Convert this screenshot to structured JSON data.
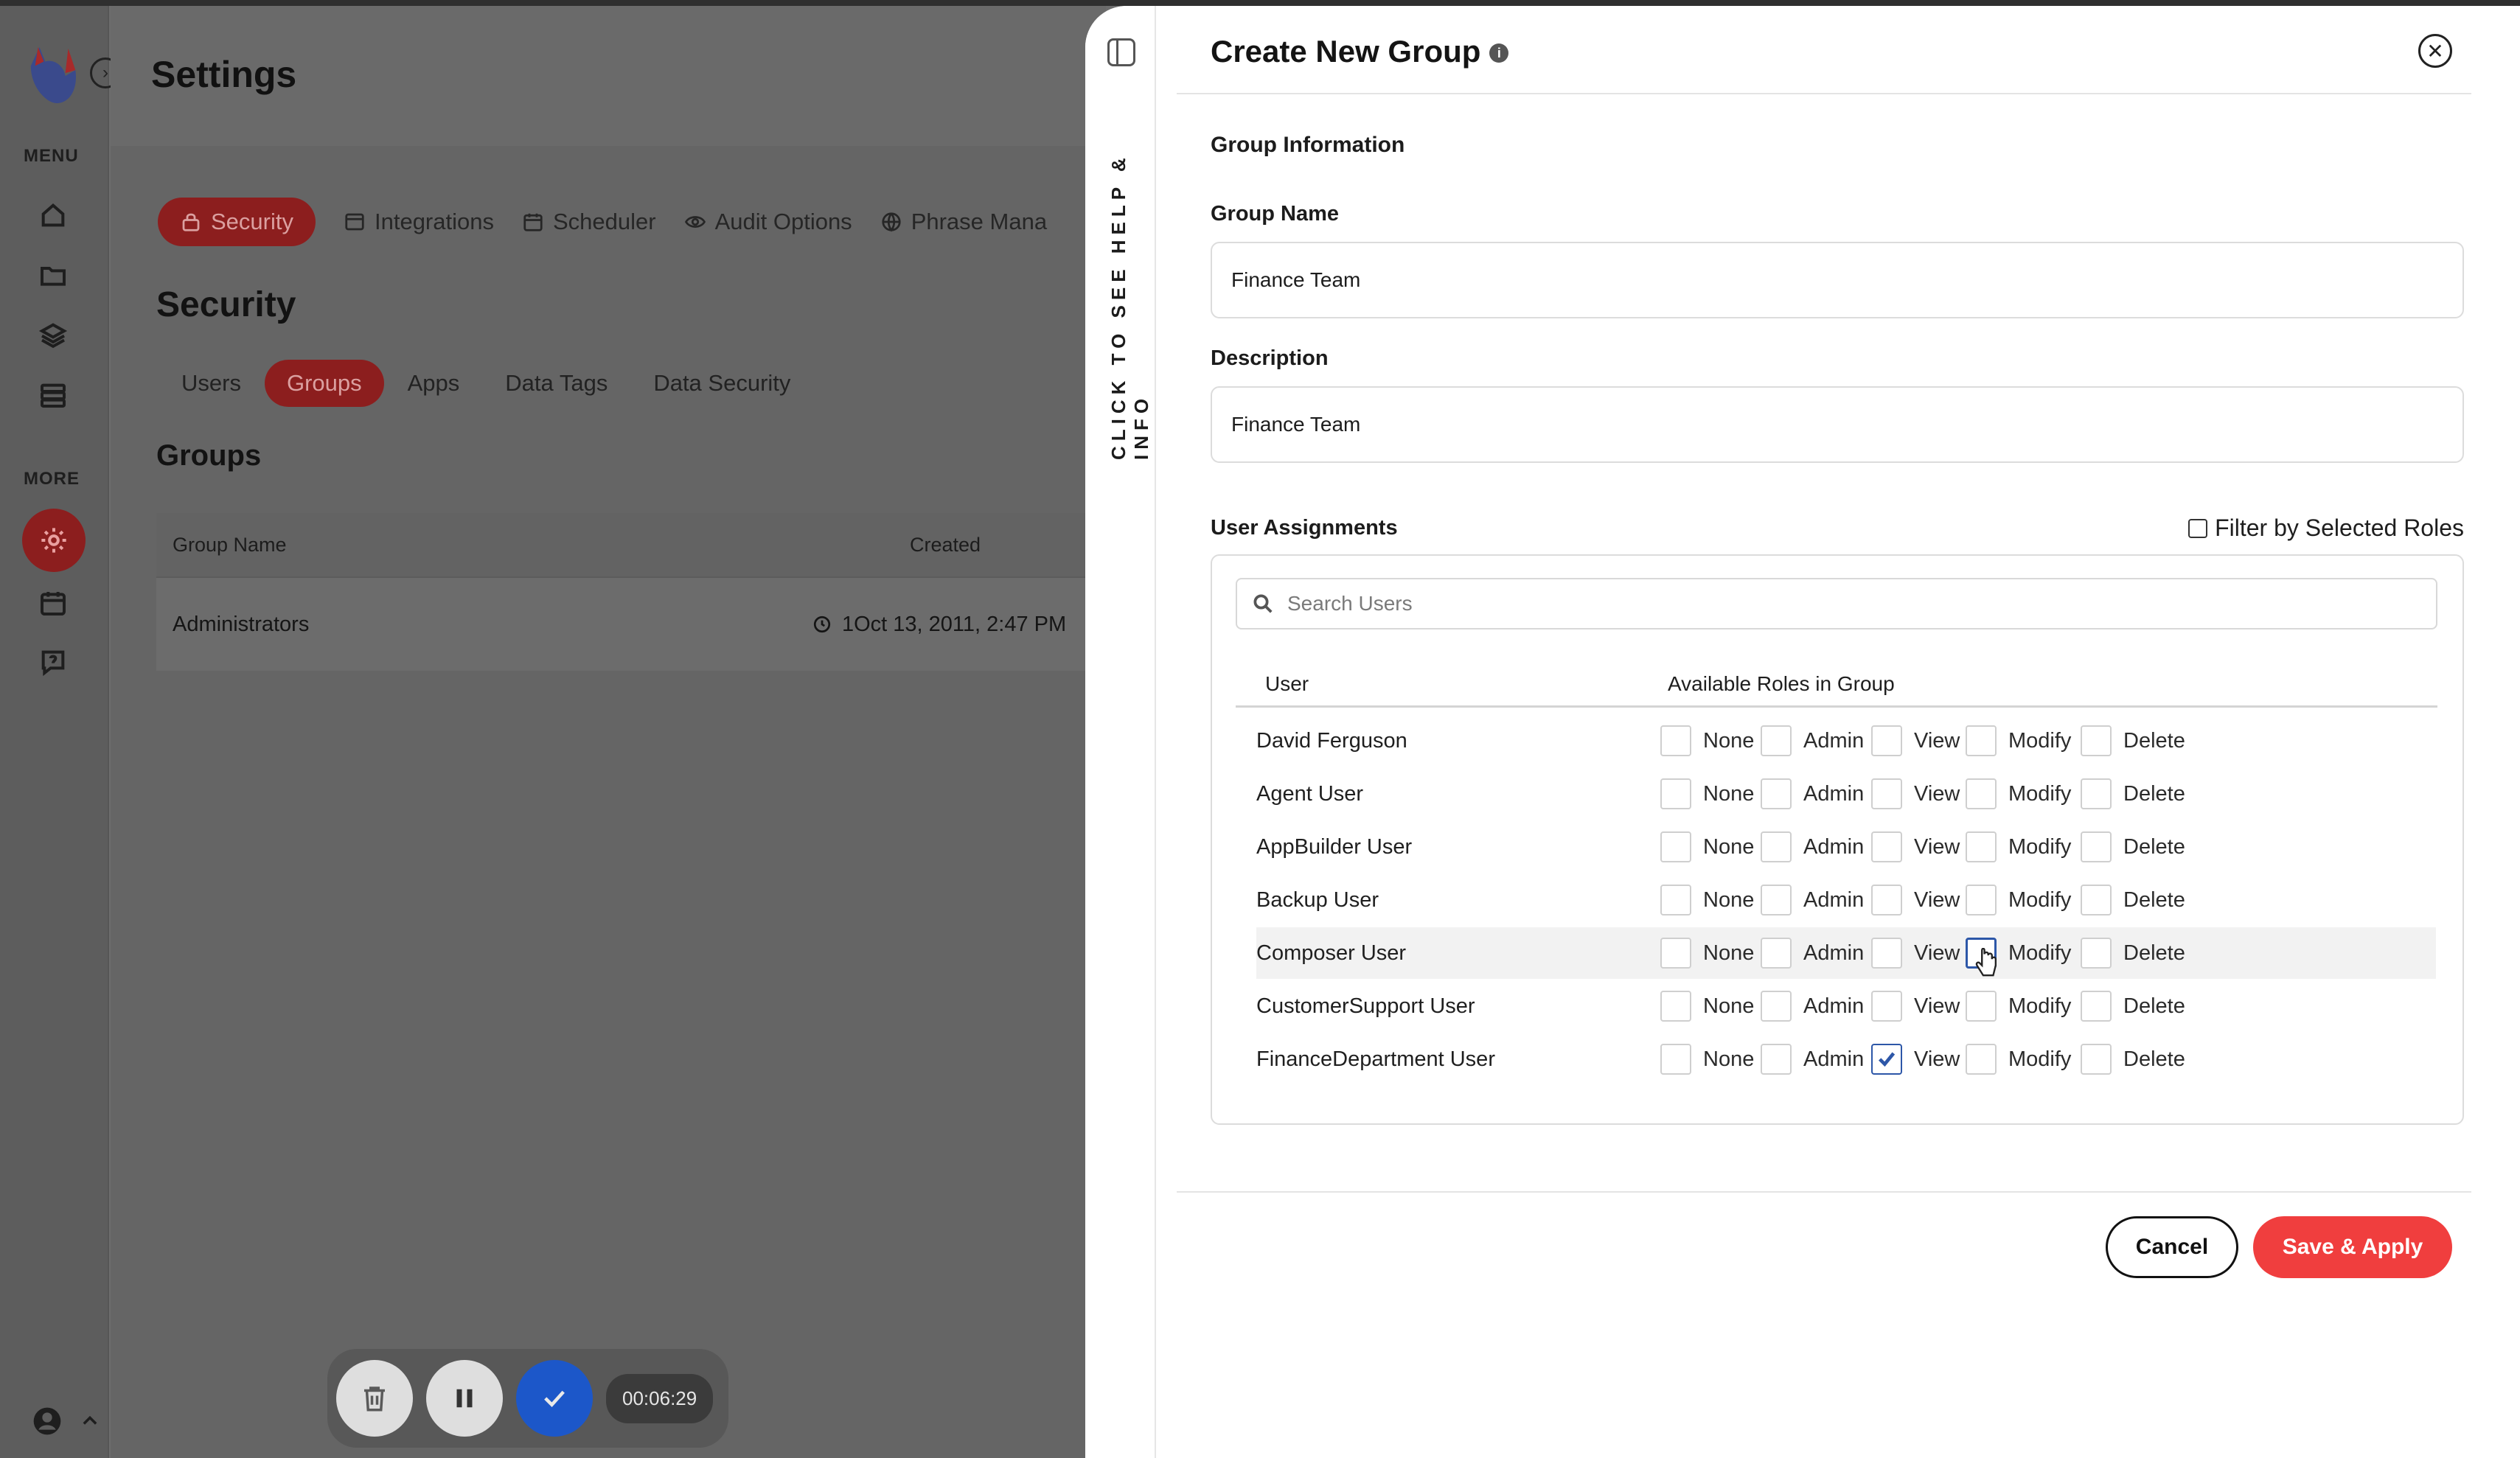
{
  "app": {
    "title": "Settings",
    "sidebar": {
      "menu_heading": "MENU",
      "more_heading": "MORE",
      "menu_icons": [
        "home-icon",
        "folder-icon",
        "layers-icon",
        "database-icon"
      ],
      "more_icons": [
        "gear-icon",
        "calendar-icon",
        "help-chat-icon"
      ]
    },
    "top_tabs": [
      {
        "label": "Security",
        "icon": "lock-icon",
        "active": true
      },
      {
        "label": "Integrations",
        "icon": "window-icon",
        "active": false
      },
      {
        "label": "Scheduler",
        "icon": "calendar-icon",
        "active": false
      },
      {
        "label": "Audit Options",
        "icon": "eye-icon",
        "active": false
      },
      {
        "label": "Phrase Mana",
        "icon": "globe-icon",
        "active": false
      }
    ],
    "section_title": "Security",
    "sub_tabs": [
      {
        "label": "Users",
        "active": false
      },
      {
        "label": "Groups",
        "active": true
      },
      {
        "label": "Apps",
        "active": false
      },
      {
        "label": "Data Tags",
        "active": false
      },
      {
        "label": "Data Security",
        "active": false
      }
    ],
    "groups_title": "Groups",
    "groups_table": {
      "columns": [
        "Group Name",
        "Created"
      ],
      "rows": [
        {
          "name": "Administrators",
          "created": "1Oct 13, 2011, 2:47 PM"
        }
      ]
    }
  },
  "recorder": {
    "timer": "00:06:29"
  },
  "panel": {
    "help_rail_text": "CLICK TO SEE HELP & INFO",
    "title": "Create New Group",
    "section_group_info": "Group Information",
    "group_name_label": "Group Name",
    "group_name_value": "Finance Team",
    "description_label": "Description",
    "description_value": "Finance Team",
    "user_assignments_label": "User Assignments",
    "filter_label": "Filter by Selected Roles",
    "search_placeholder": "Search Users",
    "table_headers": {
      "user": "User",
      "roles": "Available Roles in Group"
    },
    "role_labels": [
      "None",
      "Admin",
      "View",
      "Modify",
      "Delete"
    ],
    "users": [
      {
        "name": "David Ferguson",
        "checked": []
      },
      {
        "name": "Agent User",
        "checked": []
      },
      {
        "name": "AppBuilder User",
        "checked": []
      },
      {
        "name": "Backup User",
        "checked": []
      },
      {
        "name": "Composer User",
        "checked": [],
        "hover": true,
        "focus": "Modify"
      },
      {
        "name": "CustomerSupport User",
        "checked": []
      },
      {
        "name": "FinanceDepartment User",
        "checked": [
          "View"
        ]
      }
    ],
    "cancel_label": "Cancel",
    "save_label": "Save & Apply"
  },
  "colors": {
    "accent_red": "#f03e3e",
    "dim_red": "#8c1e1e",
    "check_blue": "#2d57a8",
    "recorder_blue": "#1c57c9"
  }
}
